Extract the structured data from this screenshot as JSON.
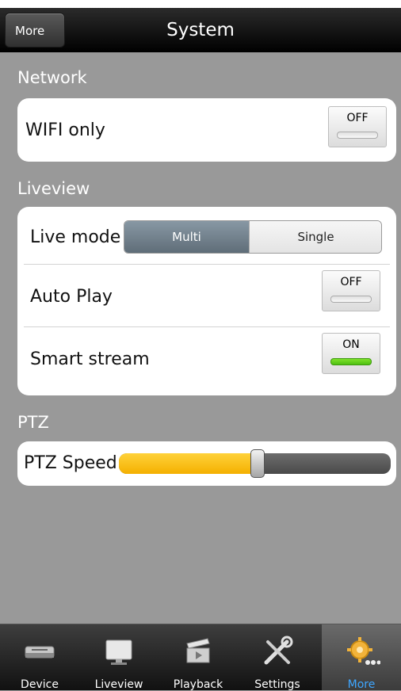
{
  "header": {
    "more_label": "More",
    "title": "System"
  },
  "network": {
    "section_label": "Network",
    "wifi_only": {
      "label": "WIFI only",
      "state": "OFF"
    }
  },
  "liveview": {
    "section_label": "Liveview",
    "live_mode": {
      "label": "Live mode",
      "options": [
        "Multi",
        "Single"
      ],
      "selected": "Multi"
    },
    "auto_play": {
      "label": "Auto Play",
      "state": "OFF"
    },
    "smart_stream": {
      "label": "Smart stream",
      "state": "ON"
    }
  },
  "ptz": {
    "section_label": "PTZ",
    "speed": {
      "label": "PTZ Speed",
      "value_fraction": 0.51
    }
  },
  "tabbar": {
    "tabs": [
      {
        "label": "Device",
        "icon": "device-icon"
      },
      {
        "label": "Liveview",
        "icon": "monitor-icon"
      },
      {
        "label": "Playback",
        "icon": "clapperboard-icon"
      },
      {
        "label": "Settings",
        "icon": "tools-icon"
      },
      {
        "label": "More",
        "icon": "gear-more-icon",
        "active": true
      }
    ]
  },
  "colors": {
    "accent_active_tab": "#3ea6ff",
    "slider_fill": "#f4b000",
    "toggle_on": "#4fc012"
  }
}
